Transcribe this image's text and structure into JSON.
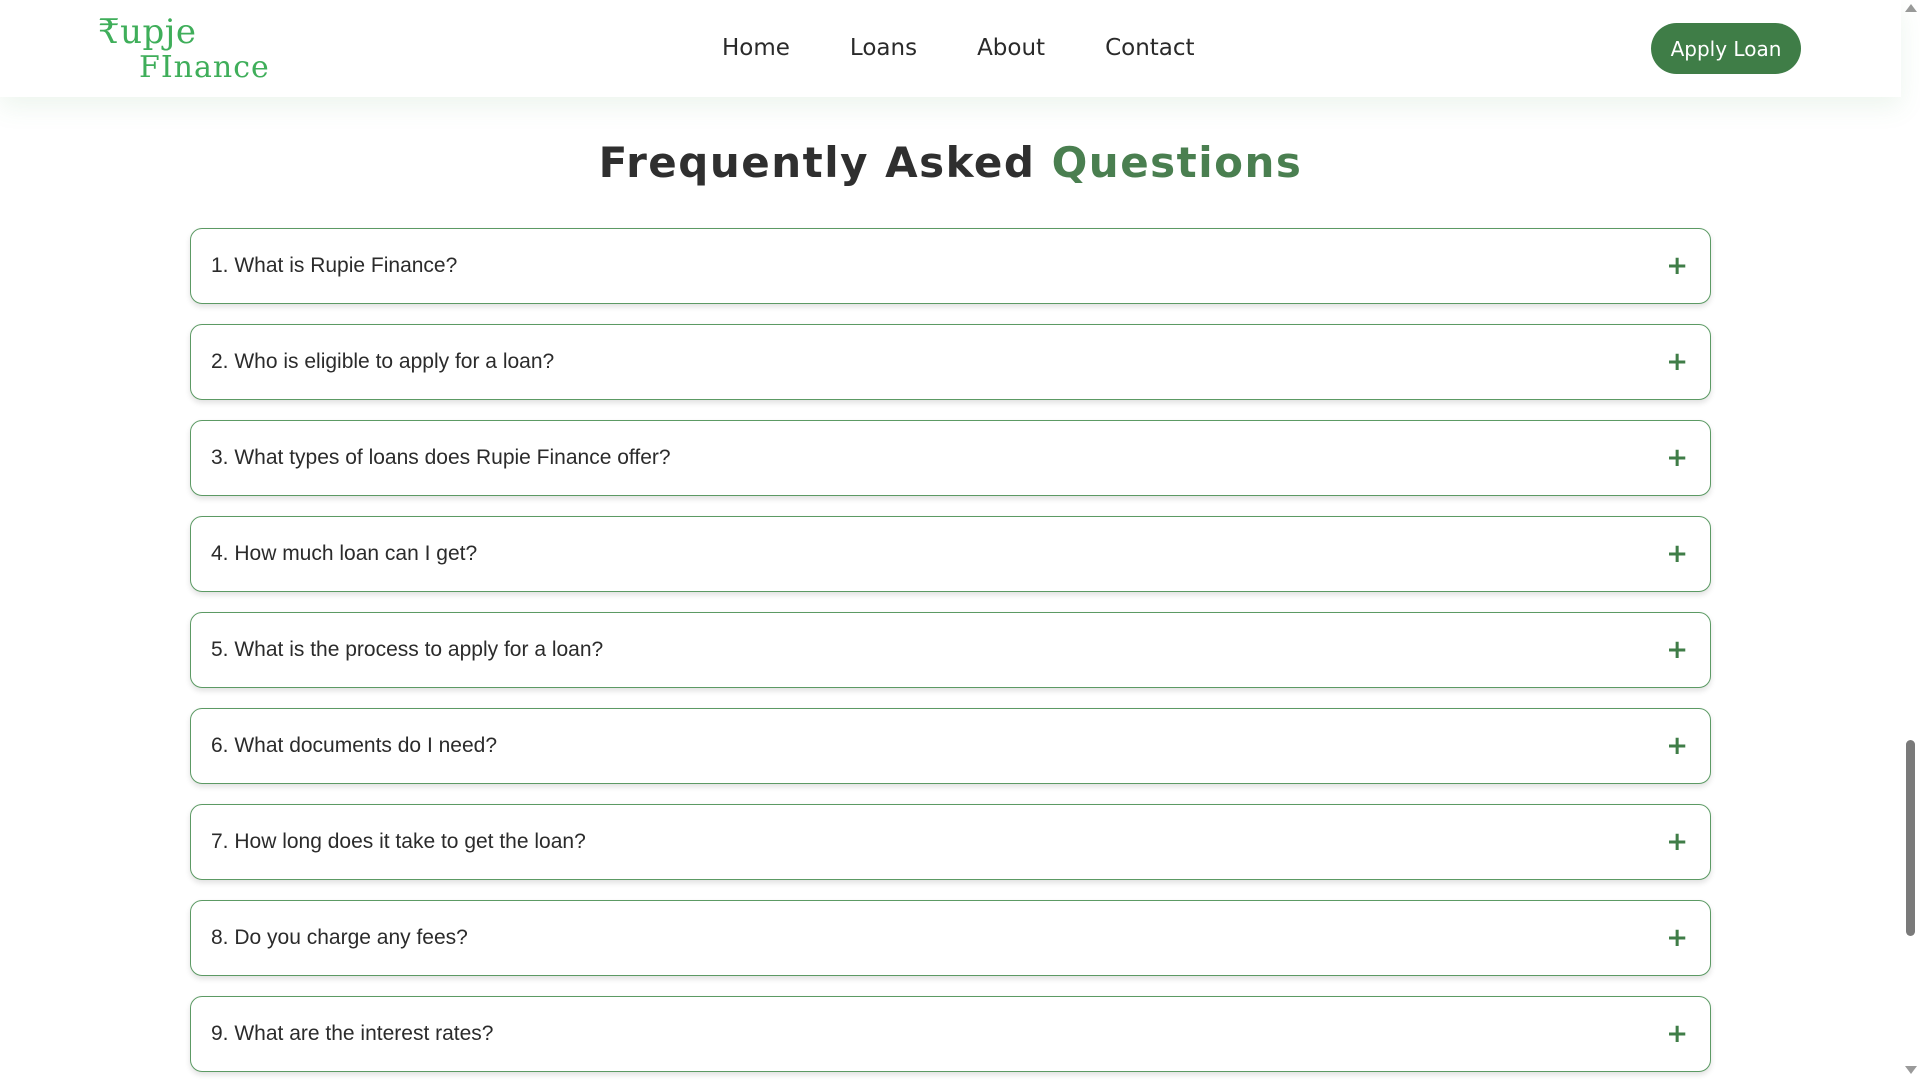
{
  "header": {
    "logo_line1": "₹upje",
    "logo_line2": "FInance",
    "nav": [
      "Home",
      "Loans",
      "About",
      "Contact"
    ],
    "apply_label": "Apply Loan"
  },
  "faq": {
    "title_main": "Frequently Asked",
    "title_accent": "Questions",
    "items": [
      "1. What is Rupie Finance?",
      "2. Who is eligible to apply for a loan?",
      "3. What types of loans does Rupie Finance offer?",
      "4. How much loan can I get?",
      "5. What is the process to apply for a loan?",
      "6. What documents do I need?",
      "7. How long does it take to get the loan?",
      "8. Do you charge any fees?",
      "9. What are the interest rates?"
    ],
    "expand_icon": "plus-icon",
    "expand_glyph": "+"
  },
  "colors": {
    "brand_green": "#3fae5a",
    "accent_green": "#4a7f50",
    "button_green": "#3f7d47"
  }
}
